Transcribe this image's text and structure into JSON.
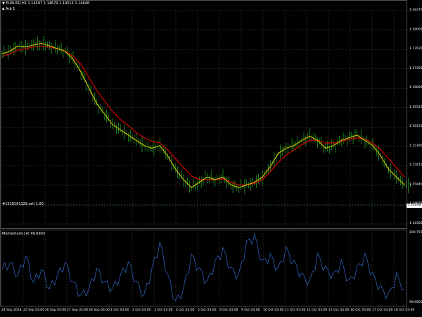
{
  "header": {
    "symbol_line": "▼ EURUSD,H1  1.14597 1.14679 1.14515 1.14648",
    "indicator_line": "▪ Arb 1"
  },
  "order_label": "#1528161329 sell 1.00",
  "momentum_label": "Momentum(14) 99.6903",
  "current_price": "1.14648",
  "price_ticks": [
    "1.18375",
    "1.18005",
    "1.17635",
    "1.17265",
    "1.16895",
    "1.16525",
    "1.16155",
    "1.15785",
    "1.15415",
    "1.15045",
    "1.14675",
    "1.14305"
  ],
  "momentum_ticks": [
    "100.7556",
    "99.6903"
  ],
  "date_ticks": [
    "24 Sep 2018",
    "25 Sep 03:00",
    "26 Sep 03:00",
    "27 Sep 03:00",
    "28 Sep 03:00",
    "1 Oct 03:00",
    "2 Oct 03:00",
    "3 Oct 03:00",
    "4 Oct 03:00",
    "5 Oct 03:00",
    "8 Oct 03:00",
    "9 Oct 03:00",
    "10 Oct 03:00",
    "11 Oct 03:00",
    "12 Oct 03:00",
    "15 Oct 03:00",
    "16 Oct 03:00",
    "17 Oct 03:00",
    "18 Oct 03:00"
  ],
  "colors": {
    "background": "#000000",
    "grid": "#4a4a4a",
    "candles": "#1f9e1f",
    "fast_ma": "#e8d000",
    "slow_ma": "#d00000",
    "momentum": "#2f5fb5",
    "axis_text": "#ffffff"
  },
  "chart_data": [
    {
      "type": "line",
      "title": "EURUSD,H1",
      "x_range": [
        "24 Sep 2018",
        "18 Oct 03:00"
      ],
      "ylim": [
        1.14305,
        1.18375
      ],
      "grid": true,
      "series": [
        {
          "name": "Arb 1",
          "values": [
            1.1755,
            1.176,
            1.177,
            1.1768,
            1.1772,
            1.1775,
            1.177,
            1.1765,
            1.176,
            1.1745,
            1.172,
            1.169,
            1.166,
            1.164,
            1.162,
            1.161,
            1.16,
            1.159,
            1.158,
            1.1575,
            1.158,
            1.156,
            1.1535,
            1.1515,
            1.15,
            1.151,
            1.152,
            1.1515,
            1.152,
            1.1505,
            1.15,
            1.1505,
            1.151,
            1.152,
            1.154,
            1.1565,
            1.1575,
            1.158,
            1.159,
            1.1598,
            1.159,
            1.1575,
            1.158,
            1.159,
            1.1595,
            1.16,
            1.159,
            1.158,
            1.156,
            1.1535,
            1.152,
            1.1505
          ]
        },
        {
          "name": "",
          "values": [
            1.175,
            1.1755,
            1.1762,
            1.1765,
            1.1768,
            1.177,
            1.1768,
            1.1765,
            1.176,
            1.175,
            1.1735,
            1.171,
            1.1685,
            1.1665,
            1.1645,
            1.163,
            1.1618,
            1.1605,
            1.1595,
            1.1588,
            1.1585,
            1.1572,
            1.1555,
            1.1538,
            1.1522,
            1.1515,
            1.1515,
            1.1515,
            1.1517,
            1.151,
            1.1505,
            1.1505,
            1.1508,
            1.1515,
            1.153,
            1.1548,
            1.1562,
            1.1572,
            1.1582,
            1.159,
            1.159,
            1.1585,
            1.1585,
            1.1588,
            1.1592,
            1.1595,
            1.1592,
            1.1585,
            1.1572,
            1.1555,
            1.1538,
            1.152
          ]
        }
      ]
    },
    {
      "type": "line",
      "title": "Momentum(14)",
      "ylim": [
        99.6903,
        100.7556
      ],
      "grid": true,
      "series": [
        {
          "name": "Momentum(14)",
          "values": [
            100.2,
            100.3,
            100.1,
            100.4,
            100.0,
            100.2,
            99.9,
            100.1,
            100.3,
            100.0,
            99.8,
            99.9,
            100.2,
            100.0,
            99.9,
            100.1,
            100.3,
            100.0,
            99.8,
            100.2,
            100.6,
            100.1,
            99.7,
            99.9,
            100.4,
            100.2,
            100.0,
            100.3,
            100.5,
            100.2,
            100.1,
            100.6,
            100.7,
            100.3,
            100.4,
            100.2,
            100.5,
            100.3,
            100.1,
            100.0,
            100.4,
            100.2,
            100.1,
            100.3,
            100.0,
            100.2,
            100.4,
            100.1,
            99.9,
            99.8,
            100.1,
            99.9
          ]
        }
      ]
    }
  ]
}
